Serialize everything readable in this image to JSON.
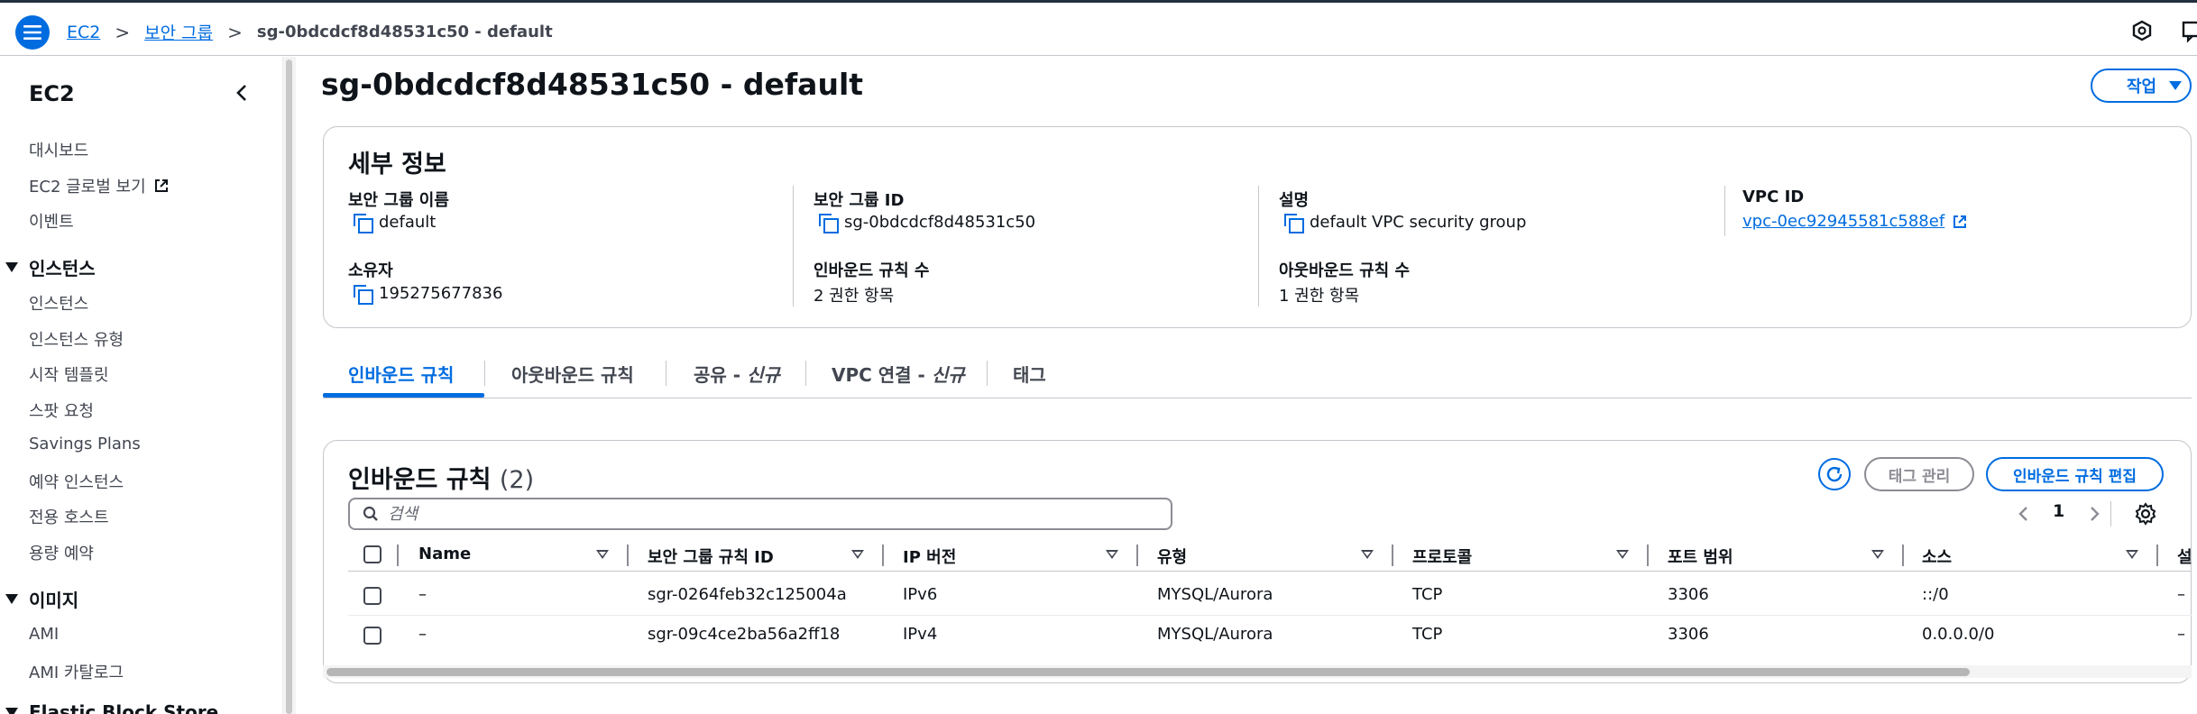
{
  "header": {
    "breadcrumbs": [
      {
        "label": "EC2",
        "link": true
      },
      {
        "label": "보안 그룹",
        "link": true
      },
      {
        "label": "sg-0bdcdcf8d48531c50 - default",
        "link": false
      }
    ]
  },
  "sidebar": {
    "title": "EC2",
    "items_top": [
      "대시보드",
      "EC2 글로벌 보기",
      "이벤트"
    ],
    "sections": [
      {
        "label": "인스턴스",
        "items": [
          "인스턴스",
          "인스턴스 유형",
          "시작 템플릿",
          "스팟 요청",
          "Savings Plans",
          "예약 인스턴스",
          "전용 호스트",
          "용량 예약"
        ]
      },
      {
        "label": "이미지",
        "items": [
          "AMI",
          "AMI 카탈로그"
        ]
      },
      {
        "label": "Elastic Block Store",
        "items": []
      }
    ]
  },
  "main": {
    "title": "sg-0bdcdcf8d48531c50 - default",
    "actions_label": "작업",
    "details": {
      "title": "세부 정보",
      "fields": [
        {
          "label": "보안 그룹 이름",
          "value": "default"
        },
        {
          "label": "보안 그룹 ID",
          "value": "sg-0bdcdcf8d48531c50"
        },
        {
          "label": "설명",
          "value": "default VPC security group"
        },
        {
          "label": "VPC ID",
          "value": "vpc-0ec92945581c588ef"
        },
        {
          "label": "소유자",
          "value": "195275677836"
        },
        {
          "label": "인바운드 규칙 수",
          "value": "2 권한 항목"
        },
        {
          "label": "아웃바운드 규칙 수",
          "value": "1 권한 항목"
        }
      ]
    },
    "tabs": [
      {
        "label": "인바운드 규칙",
        "suffix": ""
      },
      {
        "label": "아웃바운드 규칙",
        "suffix": ""
      },
      {
        "label": "공유 - ",
        "suffix": "신규"
      },
      {
        "label": "VPC 연결 - ",
        "suffix": "신규"
      },
      {
        "label": "태그",
        "suffix": ""
      }
    ],
    "rules": {
      "title": "인바운드 규칙",
      "count": "(2)",
      "manage_tags_label": "태그 관리",
      "edit_label": "인바운드 규칙 편집",
      "search_placeholder": "검색",
      "page": "1",
      "columns": [
        "Name",
        "보안 그룹 규칙 ID",
        "IP 버전",
        "유형",
        "프로토콜",
        "포트 범위",
        "소스",
        "설"
      ],
      "rows": [
        [
          "–",
          "sgr-0264feb32c125004a",
          "IPv6",
          "MYSQL/Aurora",
          "TCP",
          "3306",
          "::/0",
          "–"
        ],
        [
          "–",
          "sgr-09c4ce2ba56a2ff18",
          "IPv4",
          "MYSQL/Aurora",
          "TCP",
          "3306",
          "0.0.0.0/0",
          "–"
        ]
      ]
    }
  },
  "colors": {
    "accent": "#006ce0",
    "header_border": "#232f3e",
    "text": "#0f141a",
    "border": "#c6c6cd"
  }
}
